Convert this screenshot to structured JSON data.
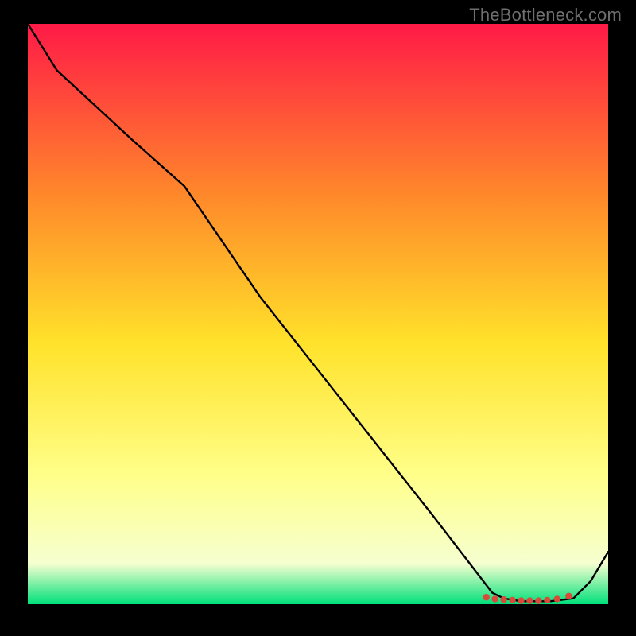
{
  "watermark": "TheBottleneck.com",
  "chart_data": {
    "type": "line",
    "title": "",
    "xlabel": "",
    "ylabel": "",
    "xlim": [
      0,
      100
    ],
    "ylim": [
      0,
      100
    ],
    "grid": false,
    "legend": false,
    "background_gradient": {
      "top": "#ff1a47",
      "mid_upper": "#ff8a2a",
      "mid": "#ffe22a",
      "mid_lower": "#ffff8a",
      "near_bottom": "#f6ffd0",
      "bottom": "#00e07a"
    },
    "series": [
      {
        "name": "curve",
        "color": "#000000",
        "x": [
          0,
          5,
          18,
          27,
          40,
          55,
          70,
          80,
          82,
          85,
          90,
          94,
          97,
          100
        ],
        "y": [
          100,
          92,
          80,
          72,
          53,
          34,
          15,
          2,
          1,
          0.5,
          0.5,
          1,
          4,
          9
        ]
      }
    ],
    "markers": {
      "name": "bottom-cluster",
      "color": "#d94a3a",
      "points": [
        {
          "x": 79,
          "y": 1.2
        },
        {
          "x": 80.5,
          "y": 0.9
        },
        {
          "x": 82,
          "y": 0.8
        },
        {
          "x": 83.5,
          "y": 0.7
        },
        {
          "x": 85,
          "y": 0.6
        },
        {
          "x": 86.5,
          "y": 0.6
        },
        {
          "x": 88,
          "y": 0.6
        },
        {
          "x": 89.5,
          "y": 0.7
        },
        {
          "x": 91.2,
          "y": 0.9
        },
        {
          "x": 93.2,
          "y": 1.4
        }
      ]
    }
  }
}
